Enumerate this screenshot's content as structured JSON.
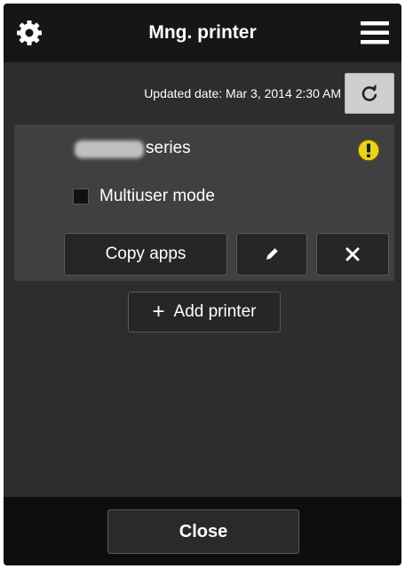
{
  "header": {
    "title": "Mng. printer",
    "left_icon": "gear-icon",
    "right_icon": "hamburger-menu-icon"
  },
  "status": {
    "updated_text": "Updated date: Mar 3, 2014 2:30 AM",
    "refresh_icon": "refresh-icon"
  },
  "printer": {
    "name_suffix": "series",
    "warning_icon": "warning-icon",
    "warning_color": "#e8d21c",
    "multiuser_label": "Multiuser mode",
    "multiuser_checked": false,
    "copy_apps_label": "Copy apps",
    "edit_icon": "pencil-icon",
    "delete_icon": "close-icon"
  },
  "actions": {
    "add_printer_label": "Add printer",
    "add_icon": "plus-icon"
  },
  "footer": {
    "close_label": "Close"
  }
}
